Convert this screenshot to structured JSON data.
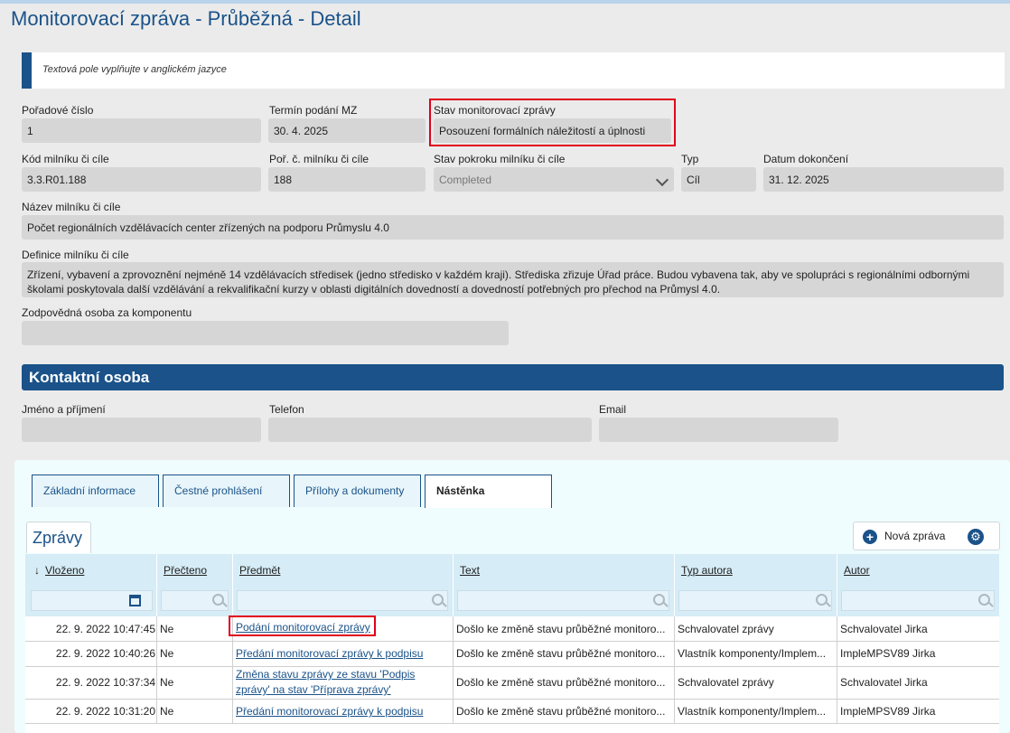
{
  "page_title": "Monitorovací zpráva - Průběžná - Detail",
  "info_note": "Textová pole vyplňujte v anglickém jazyce",
  "fields": {
    "poradove_label": "Pořadové číslo",
    "poradove_value": "1",
    "termin_label": "Termín podání MZ",
    "termin_value": "30. 4. 2025",
    "stav_label": "Stav monitorovací zprávy",
    "stav_value": "Posouzení formálních náležitostí a úplnosti",
    "kod_label": "Kód milníku či cíle",
    "kod_value": "3.3.R01.188",
    "por_label": "Poř. č. milníku či cíle",
    "por_value": "188",
    "stavpokroku_label": "Stav pokroku milníku či cíle",
    "stavpokroku_value": "Completed",
    "typ_label": "Typ",
    "typ_value": "Cíl",
    "datum_label": "Datum dokončení",
    "datum_value": "31. 12. 2025",
    "nazev_label": "Název milníku či cíle",
    "nazev_value": "Počet regionálních vzdělávacích center zřízených na podporu Průmyslu 4.0",
    "definice_label": "Definice milníku či cíle",
    "definice_value": "Zřízení, vybavení a zprovoznění nejméně 14 vzdělávacích středisek (jedno středisko v každém kraji). Střediska zřizuje Úřad práce. Budou vybavena tak, aby ve spolupráci s regionálními odbornými školami poskytovala další vzdělávání a rekvalifikační kurzy v oblasti digitálních dovedností a dovedností potřebných pro přechod na Průmysl 4.0.",
    "zodpovedna_label": "Zodpovědná osoba za komponentu",
    "zodpovedna_value": ""
  },
  "contact": {
    "section_title": "Kontaktní osoba",
    "jmeno_label": "Jméno a příjmení",
    "jmeno_value": "",
    "telefon_label": "Telefon",
    "telefon_value": "",
    "email_label": "Email",
    "email_value": ""
  },
  "tabs": [
    "Základní informace",
    "Čestné prohlášení",
    "Přílohy a dokumenty",
    "Nástěnka"
  ],
  "messages": {
    "tab_title": "Zprávy",
    "new_button": "Nová zpráva",
    "plus_glyph": "+",
    "gear_glyph": "⚙",
    "sort_arrow": "↓",
    "columns": [
      "Vloženo",
      "Přečteno",
      "Předmět",
      "Text",
      "Typ autora",
      "Autor"
    ],
    "rows": [
      {
        "vlozeno": "22. 9. 2022 10:47:45",
        "precteno": "Ne",
        "predmet": "Podání monitorovací zprávy",
        "text": "Došlo ke změně stavu průběžné monitoro...",
        "typ": "Schvalovatel zprávy",
        "autor": "Schvalovatel Jirka"
      },
      {
        "vlozeno": "22. 9. 2022 10:40:26",
        "precteno": "Ne",
        "predmet": "Předání monitorovací zprávy k podpisu",
        "text": "Došlo ke změně stavu průběžné monitoro...",
        "typ": "Vlastník komponenty/Implem...",
        "autor": "ImpleMPSV89 Jirka"
      },
      {
        "vlozeno": "22. 9. 2022 10:37:34",
        "precteno": "Ne",
        "predmet_line1": "Změna stavu zprávy ze stavu 'Podpis",
        "predmet_line2": "zprávy' na stav 'Příprava zprávy'",
        "text": "Došlo ke změně stavu průběžné monitoro...",
        "typ": "Schvalovatel zprávy",
        "autor": "Schvalovatel Jirka"
      },
      {
        "vlozeno": "22. 9. 2022 10:31:20",
        "precteno": "Ne",
        "predmet": "Předání monitorovací zprávy k podpisu",
        "text": "Došlo ke změně stavu průběžné monitoro...",
        "typ": "Vlastník komponenty/Implem...",
        "autor": "ImpleMPSV89 Jirka"
      }
    ]
  }
}
